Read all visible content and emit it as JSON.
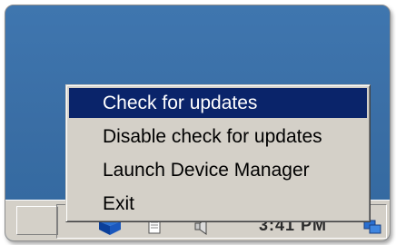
{
  "menu": {
    "items": [
      {
        "label": "Check for updates",
        "selected": true
      },
      {
        "label": "Disable check for updates",
        "selected": false
      },
      {
        "label": "Launch Device Manager",
        "selected": false
      },
      {
        "label": "Exit",
        "selected": false
      }
    ]
  },
  "tray": {
    "clock": "3:41 PM",
    "icons": [
      "update-agent-icon",
      "document-icon",
      "speaker-icon",
      "network-icon"
    ]
  },
  "colors": {
    "desktop": "#3a6ea5",
    "taskbar": "#d4d0c8",
    "menu_highlight": "#0a246a"
  }
}
